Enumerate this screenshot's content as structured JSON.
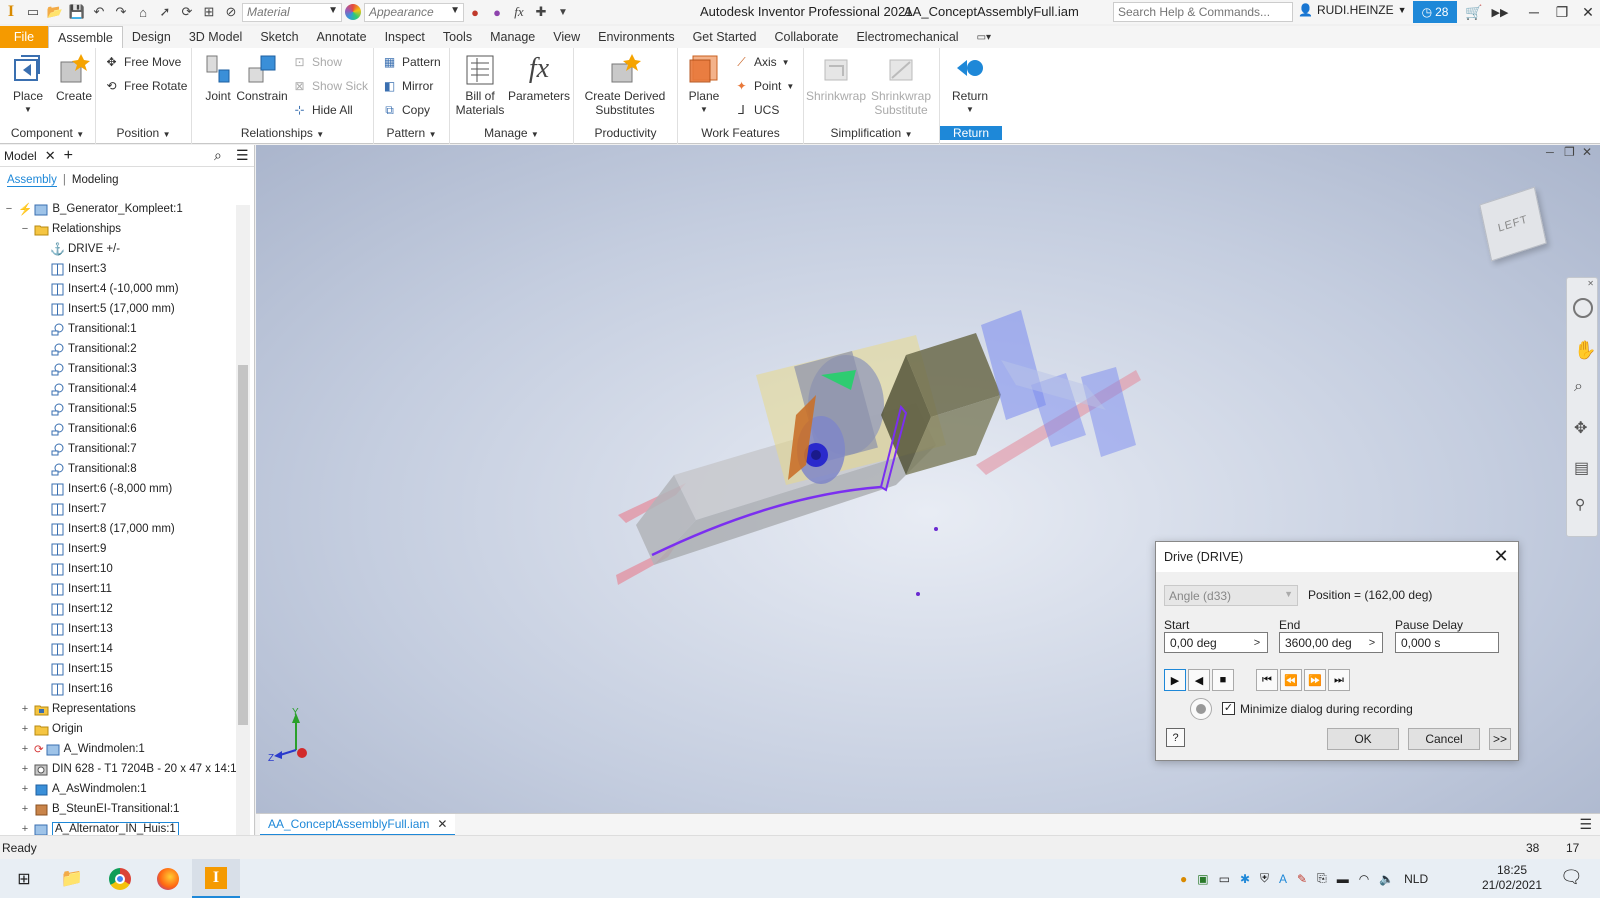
{
  "titlebar": {
    "material_placeholder": "Material",
    "appearance_placeholder": "Appearance",
    "app_title": "Autodesk Inventor Professional 2021",
    "doc_title": "AA_ConceptAssemblyFull.iam",
    "search_placeholder": "Search Help & Commands...",
    "user": "RUDI.HEINZE",
    "clock_count": "28"
  },
  "tabs": [
    "File",
    "Assemble",
    "Design",
    "3D Model",
    "Sketch",
    "Annotate",
    "Inspect",
    "Tools",
    "Manage",
    "View",
    "Environments",
    "Get Started",
    "Collaborate",
    "Electromechanical"
  ],
  "ribbon": {
    "component": {
      "label": "Component",
      "place": "Place",
      "create": "Create"
    },
    "position": {
      "label": "Position",
      "free_move": "Free Move",
      "free_rotate": "Free Rotate"
    },
    "relationships": {
      "label": "Relationships",
      "joint": "Joint",
      "constrain": "Constrain",
      "show": "Show",
      "show_sick": "Show Sick",
      "hide_all": "Hide All"
    },
    "pattern": {
      "label": "Pattern",
      "pattern": "Pattern",
      "mirror": "Mirror",
      "copy": "Copy"
    },
    "manage": {
      "label": "Manage",
      "bom_line1": "Bill of",
      "bom_line2": "Materials",
      "parameters": "Parameters"
    },
    "productivity": {
      "label": "Productivity",
      "cds_line1": "Create Derived",
      "cds_line2": "Substitutes"
    },
    "work_features": {
      "label": "Work Features",
      "plane": "Plane",
      "axis": "Axis",
      "point": "Point",
      "ucs": "UCS"
    },
    "simplification": {
      "label": "Simplification",
      "shrinkwrap": "Shrinkwrap",
      "sws_line1": "Shrinkwrap",
      "sws_line2": "Substitute"
    },
    "return": {
      "label": "Return",
      "btn": "Return"
    }
  },
  "browser": {
    "tab": "Model",
    "sub_assembly": "Assembly",
    "sub_modeling": "Modeling",
    "nodes": [
      "B_Generator_Kompleet:1",
      "Relationships",
      "DRIVE +/-",
      "Insert:3",
      "Insert:4 (-10,000 mm)",
      "Insert:5 (17,000 mm)",
      "Transitional:1",
      "Transitional:2",
      "Transitional:3",
      "Transitional:4",
      "Transitional:5",
      "Transitional:6",
      "Transitional:7",
      "Transitional:8",
      "Insert:6 (-8,000 mm)",
      "Insert:7",
      "Insert:8 (17,000 mm)",
      "Insert:9",
      "Insert:10",
      "Insert:11",
      "Insert:12",
      "Insert:13",
      "Insert:14",
      "Insert:15",
      "Insert:16",
      "Representations",
      "Origin",
      "A_Windmolen:1",
      "DIN 628 - T1 7204B - 20 x 47 x 14:1",
      "A_AsWindmolen:1",
      "B_SteunEI-Transitional:1",
      "A_Alternator_IN_Huis:1"
    ]
  },
  "viewcube_face": "LEFT",
  "doc_tab": "AA_ConceptAssemblyFull.iam",
  "status": {
    "text": "Ready",
    "num1": "38",
    "num2": "17"
  },
  "taskbar": {
    "lang": "NLD",
    "time": "18:25",
    "date": "21/02/2021"
  },
  "dialog": {
    "title": "Drive (DRIVE)",
    "angle_combo": "Angle (d33)",
    "position": "Position = (162,00 deg)",
    "start_label": "Start",
    "start_value": "0,00 deg",
    "end_label": "End",
    "end_value": "3600,00 deg",
    "pause_label": "Pause Delay",
    "pause_value": "0,000 s",
    "minimize_label": "Minimize dialog during recording",
    "minimize_checked": true,
    "ok": "OK",
    "cancel": "Cancel",
    "more": ">>"
  },
  "colors": {
    "accent": "#1e88d8",
    "file_tab": "#f59a00",
    "drive_path": "#7b2ff0"
  }
}
